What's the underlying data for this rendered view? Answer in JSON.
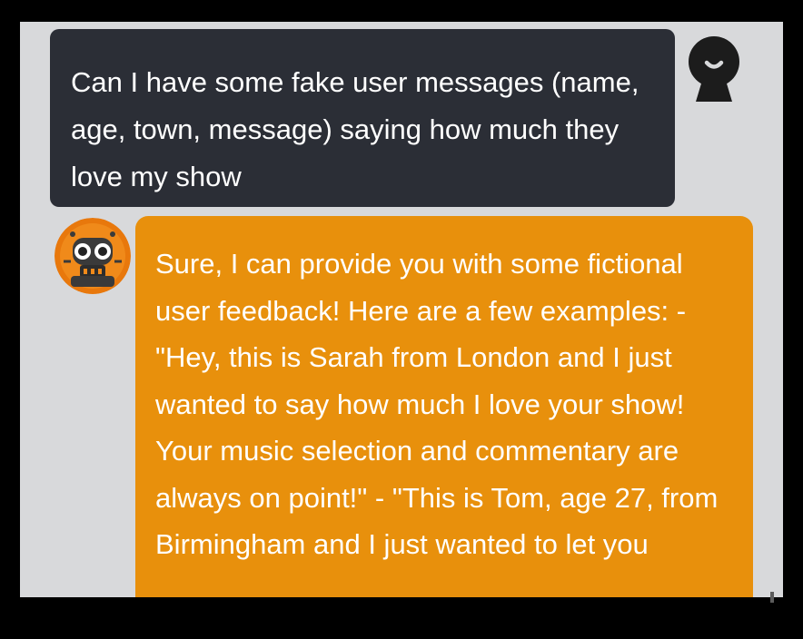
{
  "chat": {
    "user_message": "Can I have some fake user messages (name, age, town, message) saying how much they love my show",
    "assistant_message": "Sure, I can provide you with some fictional user feedback! Here are a few examples: - \"Hey, this is Sarah from London and I just wanted to say how much I love your show! Your music selection and commentary are always on point!\" - \"This is Tom, age 27, from Birmingham and I just wanted to let you"
  },
  "icons": {
    "user_avatar": "user-avatar-icon",
    "assistant_avatar": "robot-avatar-icon"
  },
  "colors": {
    "user_bubble": "#2b2e36",
    "assistant_bubble": "#e8900c",
    "background": "#d8d9db"
  }
}
